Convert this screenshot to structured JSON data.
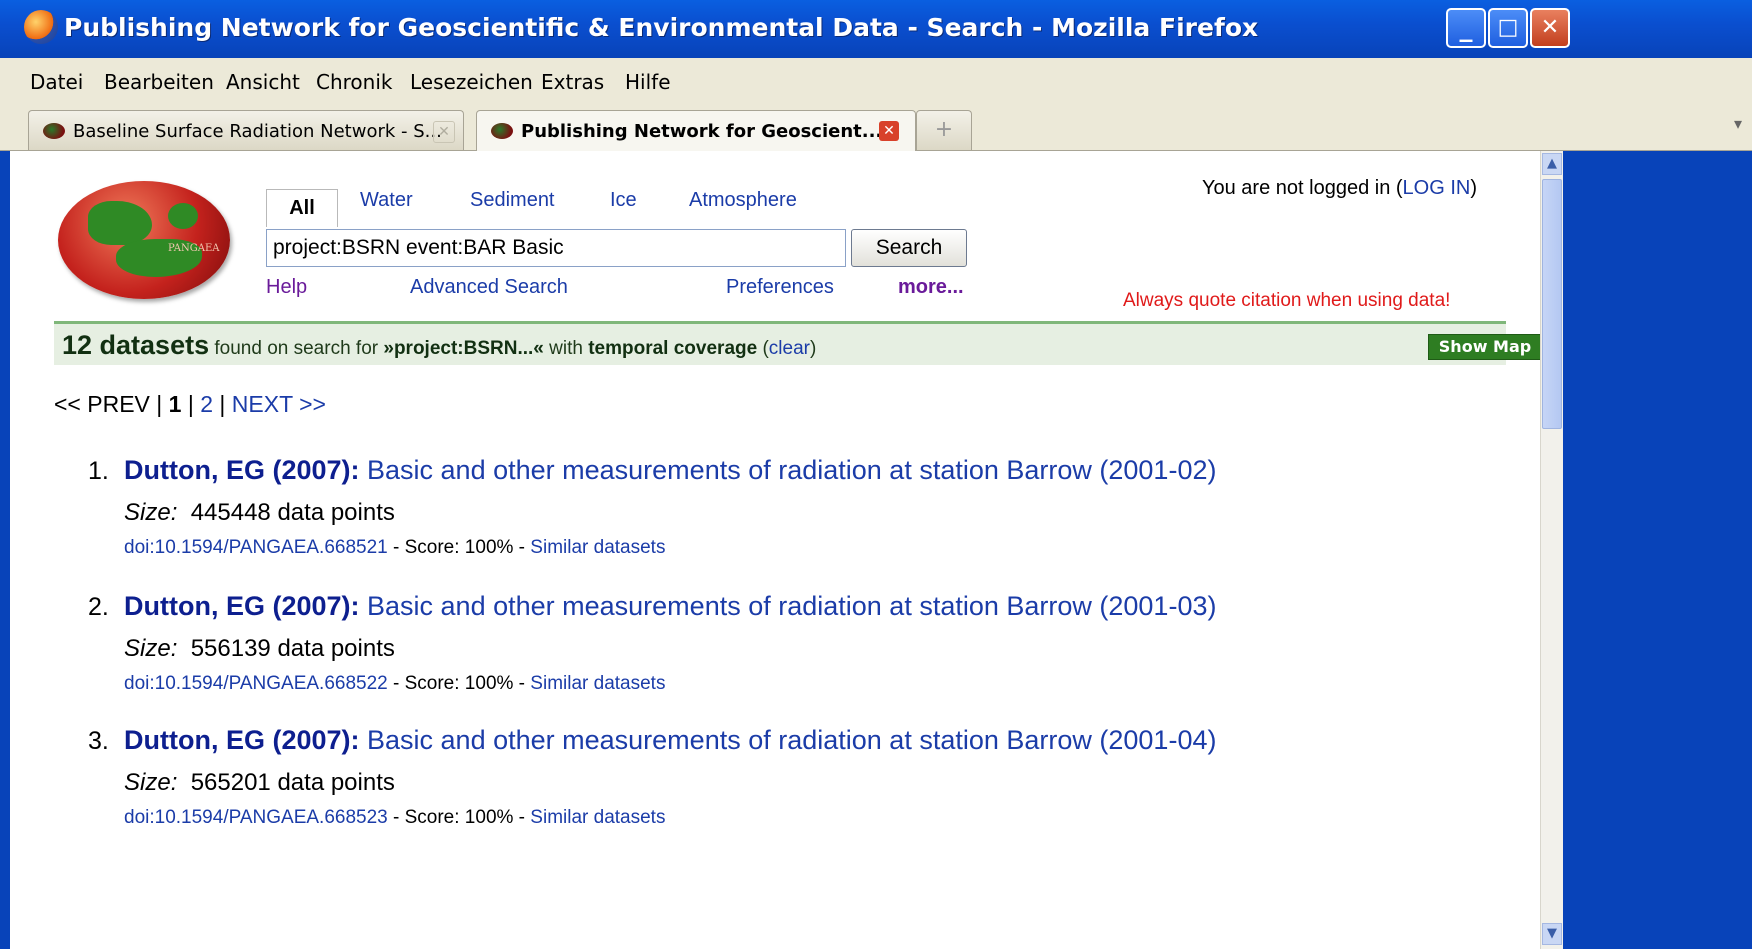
{
  "window": {
    "title": "Publishing Network for Geoscientific & Environmental Data - Search - Mozilla Firefox",
    "buttons": {
      "minimize": "_",
      "maximize": "□",
      "close": "X"
    }
  },
  "menu": [
    "Datei",
    "Bearbeiten",
    "Ansicht",
    "Chronik",
    "Lesezeichen",
    "Extras",
    "Hilfe"
  ],
  "tabs": [
    {
      "label": "Baseline Surface Radiation Network - S...",
      "active": false
    },
    {
      "label": "Publishing Network for Geoscient...",
      "active": true
    }
  ],
  "newtab_label": "+",
  "header": {
    "logo_text": "PANGAEA",
    "login_prefix": "You are not logged in (",
    "login_link": "LOG IN",
    "login_suffix": ")",
    "quote_notice": "Always quote citation when using data!"
  },
  "search": {
    "tabs": [
      "All",
      "Water",
      "Sediment",
      "Ice",
      "Atmosphere"
    ],
    "selected_tab": "All",
    "query": "project:BSRN event:BAR Basic",
    "button": "Search",
    "links": {
      "help": "Help",
      "advanced": "Advanced Search",
      "preferences": "Preferences",
      "more": "more..."
    }
  },
  "results_bar": {
    "count": "12 datasets",
    "found_text": " found on search for ",
    "query_short": "»project:BSRN...«",
    "with_text": " with ",
    "coverage": "temporal coverage",
    "clear_open": " (",
    "clear": "clear",
    "clear_close": ")",
    "show_map": "Show Map"
  },
  "pager": {
    "prev": "<< PREV",
    "sep": " | ",
    "current": "1",
    "page2": "2",
    "next": "NEXT >>"
  },
  "results": [
    {
      "num": "1.",
      "author": "Dutton, EG (2007):",
      "title": " Basic and other measurements of radiation at station Barrow (2001-02)",
      "size_label": "Size:",
      "size_value": "  445448 data points",
      "doi": "doi:10.1594/PANGAEA.668521",
      "score": " - Score: 100% - ",
      "similar": "Similar datasets"
    },
    {
      "num": "2.",
      "author": "Dutton, EG (2007):",
      "title": " Basic and other measurements of radiation at station Barrow (2001-03)",
      "size_label": "Size:",
      "size_value": "  556139 data points",
      "doi": "doi:10.1594/PANGAEA.668522",
      "score": " - Score: 100% - ",
      "similar": "Similar datasets"
    },
    {
      "num": "3.",
      "author": "Dutton, EG (2007):",
      "title": " Basic and other measurements of radiation at station Barrow (2001-04)",
      "size_label": "Size:",
      "size_value": "  565201 data points",
      "doi": "doi:10.1594/PANGAEA.668523",
      "score": " - Score: 100% - ",
      "similar": "Similar datasets"
    }
  ]
}
